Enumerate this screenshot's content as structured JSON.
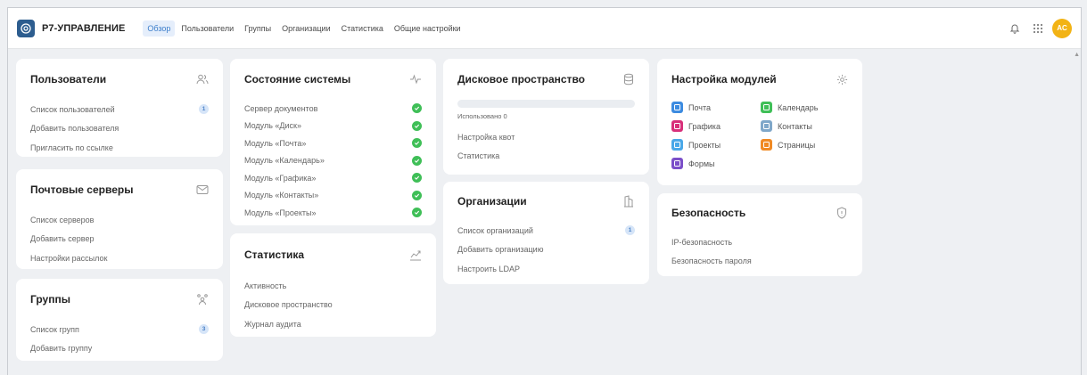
{
  "header": {
    "logo_text": "Р7-УПРАВЛЕНИЕ",
    "nav": [
      "Обзор",
      "Пользователи",
      "Группы",
      "Организации",
      "Статистика",
      "Общие настройки"
    ],
    "active_nav": "Обзор",
    "avatar_initials": "AC"
  },
  "users_card": {
    "title": "Пользователи",
    "links": [
      {
        "label": "Список пользователей",
        "badge": "1"
      },
      {
        "label": "Добавить пользователя"
      },
      {
        "label": "Пригласить по ссылке"
      }
    ]
  },
  "mail_card": {
    "title": "Почтовые серверы",
    "links": [
      {
        "label": "Список серверов"
      },
      {
        "label": "Добавить сервер"
      },
      {
        "label": "Настройки рассылок"
      }
    ]
  },
  "groups_card": {
    "title": "Группы",
    "links": [
      {
        "label": "Список групп",
        "badge": "3"
      },
      {
        "label": "Добавить группу"
      }
    ]
  },
  "system_card": {
    "title": "Состояние системы",
    "items": [
      "Сервер документов",
      "Модуль «Диск»",
      "Модуль «Почта»",
      "Модуль «Календарь»",
      "Модуль «Графика»",
      "Модуль «Контакты»",
      "Модуль «Проекты»"
    ]
  },
  "stats_card": {
    "title": "Статистика",
    "links": [
      {
        "label": "Активность"
      },
      {
        "label": "Дисковое пространство"
      },
      {
        "label": "Журнал аудита"
      }
    ]
  },
  "disk_card": {
    "title": "Дисковое пространство",
    "used_label": "Использовано 0",
    "used_fraction": 0,
    "links": [
      {
        "label": "Настройка квот"
      },
      {
        "label": "Статистика"
      }
    ]
  },
  "orgs_card": {
    "title": "Организации",
    "links": [
      {
        "label": "Список организаций",
        "badge": "1"
      },
      {
        "label": "Добавить организацию"
      },
      {
        "label": "Настроить LDAP"
      }
    ]
  },
  "modules_card": {
    "title": "Настройка модулей",
    "modules": [
      {
        "label": "Почта",
        "color": "#3c8be0"
      },
      {
        "label": "Календарь",
        "color": "#3fbf57"
      },
      {
        "label": "Графика",
        "color": "#d8307a"
      },
      {
        "label": "Контакты",
        "color": "#7fa7c9"
      },
      {
        "label": "Проекты",
        "color": "#4aa8e8"
      },
      {
        "label": "Страницы",
        "color": "#f08a24"
      },
      {
        "label": "Формы",
        "color": "#7b4fc9"
      }
    ]
  },
  "security_card": {
    "title": "Безопасность",
    "links": [
      {
        "label": "IP-безопасность"
      },
      {
        "label": "Безопасность пароля"
      }
    ]
  }
}
